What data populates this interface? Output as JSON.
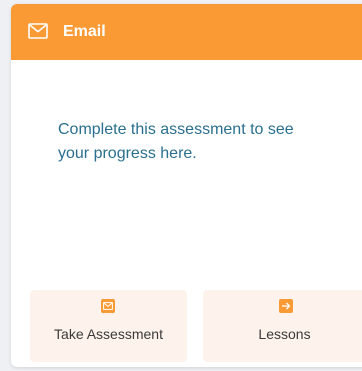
{
  "card": {
    "title": "Email",
    "icon": "envelope-icon",
    "message": "Complete this assessment to see your progress here."
  },
  "actions": [
    {
      "label": "Take Assessment",
      "icon": "envelope-icon"
    },
    {
      "label": "Lessons",
      "icon": "arrow-right-icon"
    }
  ],
  "colors": {
    "header": "#f99a35",
    "message_text": "#2a6f8f",
    "action_bg": "#fdf3ec",
    "page_bg": "#eef0f4"
  }
}
